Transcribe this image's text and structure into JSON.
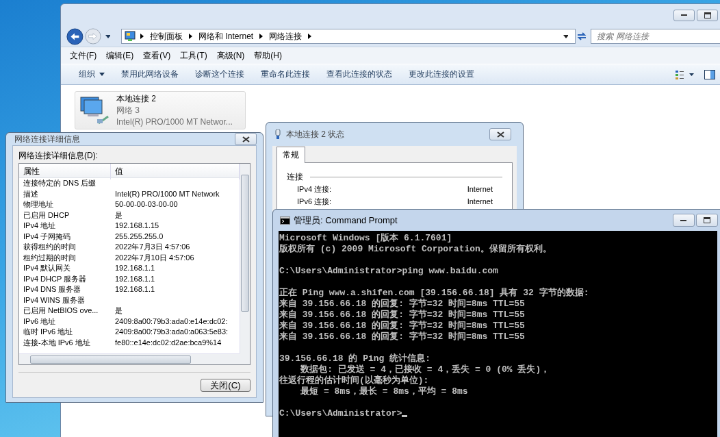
{
  "explorer": {
    "address_path": [
      "控制面板",
      "网络和 Internet",
      "网络连接"
    ],
    "search": {
      "placeholder": "搜索 网络连接"
    },
    "menu": [
      "文件(F)",
      "编辑(E)",
      "查看(V)",
      "工具(T)",
      "高级(N)",
      "帮助(H)"
    ],
    "commands": [
      {
        "label": "组织",
        "kind": "menu"
      },
      {
        "label": "禁用此网络设备",
        "kind": "action"
      },
      {
        "label": "诊断这个连接",
        "kind": "action"
      },
      {
        "label": "重命名此连接",
        "kind": "action"
      },
      {
        "label": "查看此连接的状态",
        "kind": "action"
      },
      {
        "label": "更改此连接的设置",
        "kind": "action"
      }
    ],
    "items": [
      {
        "name": "本地连接 2",
        "network": "网络  3",
        "adapter": "Intel(R) PRO/1000 MT Networ..."
      }
    ]
  },
  "details_window": {
    "title": "网络连接详细信息",
    "label": "网络连接详细信息(D):",
    "columns": [
      "属性",
      "值"
    ],
    "rows": [
      {
        "property": "连接特定的 DNS 后缀"
      },
      {
        "property": "描述",
        "value": "Intel(R) PRO/1000 MT Network"
      },
      {
        "property": "物理地址",
        "value": "50-00-00-03-00-00"
      },
      {
        "property": "已启用 DHCP",
        "value": "是"
      },
      {
        "property": "IPv4 地址",
        "value": "192.168.1.15"
      },
      {
        "property": "IPv4 子网掩码",
        "value": "255.255.255.0"
      },
      {
        "property": "获得租约的时间",
        "value": "2022年7月3日 4:57:06"
      },
      {
        "property": "租约过期的时间",
        "value": "2022年7月10日 4:57:06"
      },
      {
        "property": "IPv4 默认网关",
        "value": "192.168.1.1"
      },
      {
        "property": "IPv4 DHCP 服务器",
        "value": "192.168.1.1"
      },
      {
        "property": "IPv4 DNS 服务器",
        "value": "192.168.1.1"
      },
      {
        "property": "IPv4 WINS 服务器"
      },
      {
        "property": "已启用 NetBIOS ove...",
        "value": "是"
      },
      {
        "property": "IPv6 地址",
        "value": "2409:8a00:79b3:ada0:e14e:dc02:"
      },
      {
        "property": "临时 IPv6 地址",
        "value": "2409:8a00:79b3:ada0:a063:5e83:"
      },
      {
        "property": "连接-本地 IPv6 地址",
        "value": "fe80::e14e:dc02:d2ae:bca9%14"
      }
    ],
    "close_button": "关闭(C)"
  },
  "status_window": {
    "title": "本地连接 2 状态",
    "tabs": [
      {
        "label": "常规",
        "selected": true
      }
    ],
    "group": "连接",
    "rows": [
      {
        "label": "IPv4 连接:",
        "value": "Internet"
      },
      {
        "label": "IPv6 连接:",
        "value": "Internet"
      }
    ]
  },
  "cmd_window": {
    "title": "管理员: Command Prompt",
    "blocks": [
      [
        "Microsoft Windows [版本 6.1.7601]",
        "版权所有 (c) 2009 Microsoft Corporation。保留所有权利。"
      ],
      [
        "C:\\Users\\Administrator>ping www.baidu.com"
      ],
      [
        "正在 Ping www.a.shifen.com [39.156.66.18] 具有 32 字节的数据:",
        "来自 39.156.66.18 的回复: 字节=32 时间=8ms TTL=55",
        "来自 39.156.66.18 的回复: 字节=32 时间=8ms TTL=55",
        "来自 39.156.66.18 的回复: 字节=32 时间=8ms TTL=55",
        "来自 39.156.66.18 的回复: 字节=32 时间=8ms TTL=55"
      ],
      [
        "39.156.66.18 的 Ping 统计信息:",
        "    数据包: 已发送 = 4，已接收 = 4，丢失 = 0 (0% 丢失)，",
        "往返行程的估计时间(以毫秒为单位):",
        "    最短 = 8ms，最长 = 8ms，平均 = 8ms"
      ],
      [
        "C:\\Users\\Administrator>"
      ]
    ]
  }
}
